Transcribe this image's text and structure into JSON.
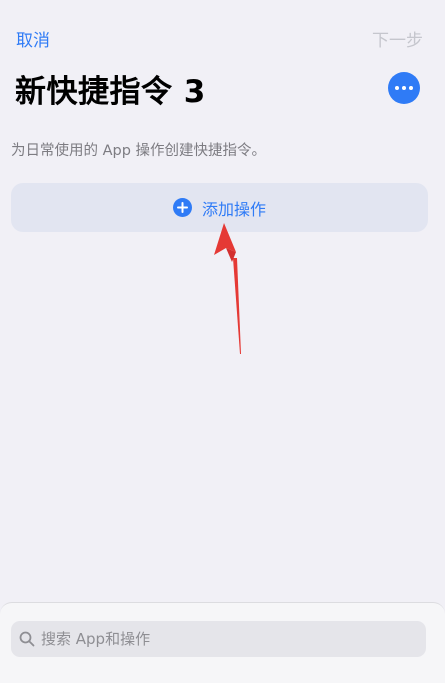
{
  "nav": {
    "cancel_label": "取消",
    "next_label": "下一步"
  },
  "title": "新快捷指令 3",
  "description": "为日常使用的 App 操作创建快捷指令。",
  "add_action": {
    "label": "添加操作",
    "icon": "plus-circle-icon"
  },
  "more_button": {
    "icon": "ellipsis-icon"
  },
  "search": {
    "placeholder": "搜索 App和操作",
    "icon": "search-icon"
  },
  "colors": {
    "accent": "#2f7bf6",
    "background": "#f1f0f6",
    "add_action_bg": "#e2e5f1",
    "disabled_text": "#c5c6cd",
    "annotation_arrow": "#e53935"
  }
}
